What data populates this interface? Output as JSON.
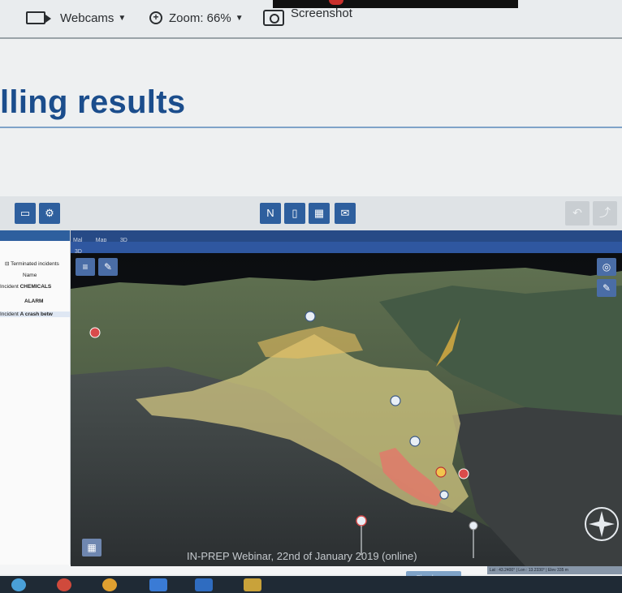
{
  "toolbar": {
    "webcams_label": "Webcams",
    "zoom_label": "Zoom: 66%",
    "screenshot_label": "Screenshot"
  },
  "slide": {
    "title": "lling results",
    "footer": "IN-PREP Webinar, 22nd of January 2019 (online)"
  },
  "app": {
    "tabs": [
      "Mal",
      "Map",
      "3D"
    ],
    "sub_tab": "3D",
    "left_panel": {
      "header": "Terminated incidents",
      "column": "Name",
      "rows": [
        {
          "prefix": "Incident",
          "name": "CHEMICALS"
        },
        {
          "prefix": "",
          "name": "ALARM"
        },
        {
          "prefix": "Incident",
          "name": "A crash betw"
        }
      ]
    },
    "status_bar": "Lat : 43.2400° | Lon : 13.2330° | Elev 335 m",
    "action_button": "Play changes"
  },
  "colors": {
    "brand_blue": "#1b4d8c",
    "app_button": "#2e5f9e",
    "hazard_zone": "#e8d98a",
    "impact_zone": "#e07a6a"
  }
}
